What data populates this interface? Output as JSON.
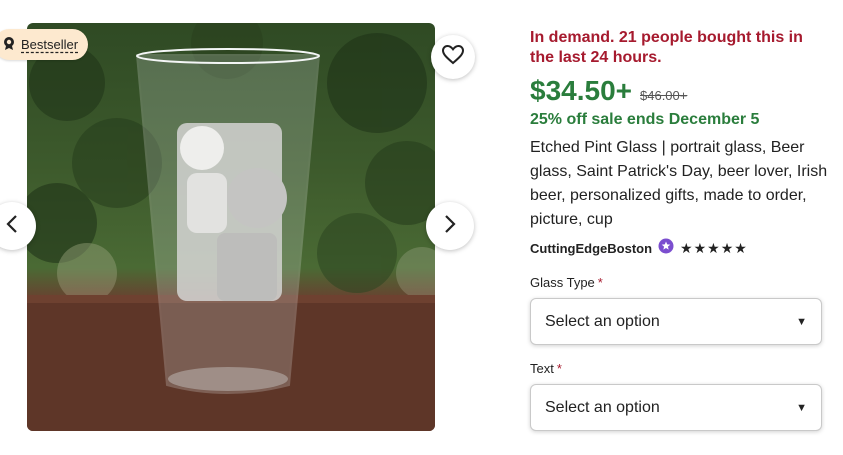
{
  "product": {
    "badge": "Bestseller",
    "demand_text": "In demand. 21 people bought this in the last 24 hours.",
    "price": "$34.50+",
    "original_price": "$46.00+",
    "sale_text": "25% off sale ends December 5",
    "title": "Etched Pint Glass | portrait glass, Beer glass, Saint Patrick's Day, beer lover, Irish beer, personalized gifts, made to order, picture, cup",
    "shop_name": "CuttingEdgeBoston",
    "stars": "★★★★★"
  },
  "options": [
    {
      "label": "Glass Type",
      "required_mark": "*",
      "value": "Select an option"
    },
    {
      "label": "Text",
      "required_mark": "*",
      "value": "Select an option"
    }
  ],
  "colors": {
    "demand": "#a61a2e",
    "price": "#2a7d3c",
    "badge_bg": "#fde9cf",
    "star_seller": "#7b4ecf"
  },
  "icons": [
    "bestseller-icon",
    "heart-icon",
    "chevron-left-icon",
    "chevron-right-icon",
    "star-seller-icon",
    "caret-down-icon"
  ]
}
